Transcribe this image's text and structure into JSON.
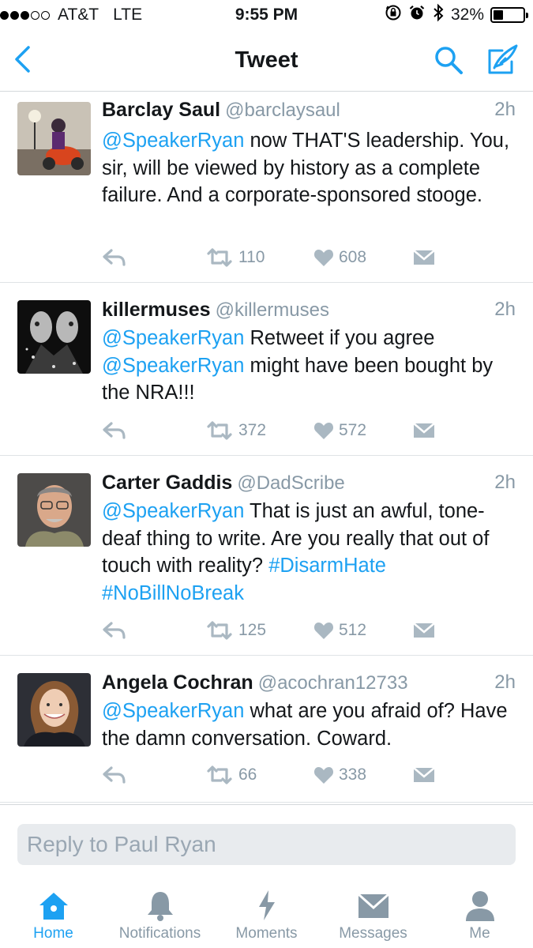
{
  "status_bar": {
    "carrier": "AT&T",
    "network": "LTE",
    "time": "9:55 PM",
    "battery_percent": "32%",
    "battery_level": 0.32,
    "signal_bars": 3
  },
  "nav": {
    "title": "Tweet",
    "back_icon": "chevron-left-icon",
    "search_icon": "search-icon",
    "compose_icon": "compose-tweet-icon"
  },
  "tweets": [
    {
      "name": "Barclay Saul",
      "handle": "@barclaysaul",
      "time": "2h",
      "mention": "@SpeakerRyan",
      "text": " now THAT'S leadership. You, sir, will be viewed by history as a complete failure. And a corporate-sponsored stooge.",
      "retweets": "110",
      "likes": "608"
    },
    {
      "name": "killermuses",
      "handle": "@killermuses",
      "time": "2h",
      "mention": "@SpeakerRyan",
      "text": " Retweet if you agree ",
      "mention2": "@SpeakerRyan",
      "text2": " might have been bought by the NRA!!!",
      "retweets": "372",
      "likes": "572"
    },
    {
      "name": "Carter Gaddis",
      "handle": "@DadScribe",
      "time": "2h",
      "mention": "@SpeakerRyan",
      "text": " That is just an awful, tone-deaf thing to write. Are you really that out of touch with reality? ",
      "hashtag1": "#DisarmHate",
      "hashtag2": "#NoBillNoBreak",
      "retweets": "125",
      "likes": "512"
    },
    {
      "name": "Angela Cochran",
      "handle": "@acochran12733",
      "time": "2h",
      "mention": "@SpeakerRyan",
      "text": " what are you afraid of? Have the damn conversation. Coward.",
      "retweets": "66",
      "likes": "338"
    }
  ],
  "reply": {
    "placeholder": "Reply to Paul Ryan",
    "value": ""
  },
  "tabs": [
    {
      "label": "Home",
      "icon": "home-icon",
      "active": true
    },
    {
      "label": "Notifications",
      "icon": "bell-icon",
      "active": false
    },
    {
      "label": "Moments",
      "icon": "lightning-icon",
      "active": false
    },
    {
      "label": "Messages",
      "icon": "envelope-icon",
      "active": false
    },
    {
      "label": "Me",
      "icon": "person-icon",
      "active": false
    }
  ],
  "colors": {
    "accent": "#1da1f2",
    "muted": "#8899a6",
    "text": "#14171a"
  }
}
